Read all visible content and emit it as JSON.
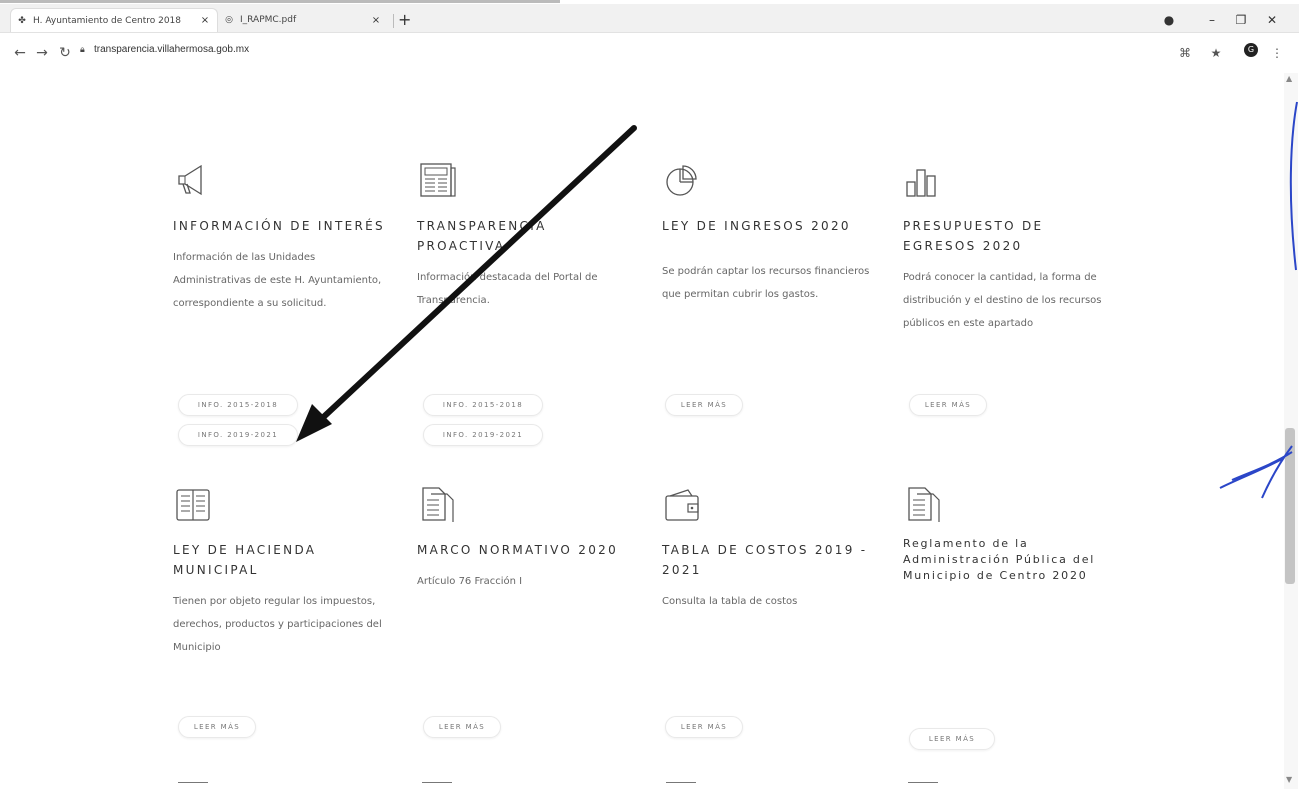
{
  "browser": {
    "tabs": [
      {
        "title": "H. Ayuntamiento de Centro 2018",
        "active": true
      },
      {
        "title": "I_RAPMC.pdf",
        "active": false
      }
    ],
    "url": "transparencia.villahermosa.gob.mx"
  },
  "cards": [
    {
      "icon": "megaphone-icon",
      "title": "INFORMACIÓN DE INTERÉS",
      "description": "Información de las Unidades Administrativas de este H. Ayuntamiento, correspondiente a su solicitud.",
      "buttons": [
        "INFO. 2015-2018",
        "INFO. 2019-2021"
      ]
    },
    {
      "icon": "newspaper-icon",
      "title": "TRANSPARENCIA PROACTIVA",
      "description": "Información destacada del Portal de Transparencia.",
      "buttons": [
        "INFO. 2015-2018",
        "INFO. 2019-2021"
      ]
    },
    {
      "icon": "pie-chart-icon",
      "title": "LEY DE INGRESOS 2020",
      "description": "Se podrán captar los recursos financieros que permitan cubrir los gastos.",
      "buttons": [
        "LEER MÁS"
      ]
    },
    {
      "icon": "bar-chart-icon",
      "title": "PRESUPUESTO DE EGRESOS 2020",
      "description": "Podrá conocer la cantidad, la forma de distribución y el destino de los recursos públicos en este apartado",
      "buttons": [
        "LEER MÁS"
      ]
    },
    {
      "icon": "book-icon",
      "title": "LEY DE HACIENDA MUNICIPAL",
      "description": "Tienen por objeto regular los impuestos, derechos, productos y participaciones del Municipio",
      "buttons": [
        "LEER MÁS"
      ]
    },
    {
      "icon": "document-icon",
      "title": "MARCO NORMATIVO 2020",
      "description": "Artículo 76 Fracción I",
      "buttons": [
        "LEER MÁS"
      ]
    },
    {
      "icon": "wallet-icon",
      "title": "TABLA DE COSTOS 2019 - 2021",
      "description": "Consulta la tabla de costos",
      "buttons": [
        "LEER MÁS"
      ]
    },
    {
      "icon": "document-icon",
      "title": "Reglamento de la Administración Pública del Municipio de Centro 2020",
      "description": "",
      "buttons": [
        "LEER MÁS"
      ]
    }
  ]
}
